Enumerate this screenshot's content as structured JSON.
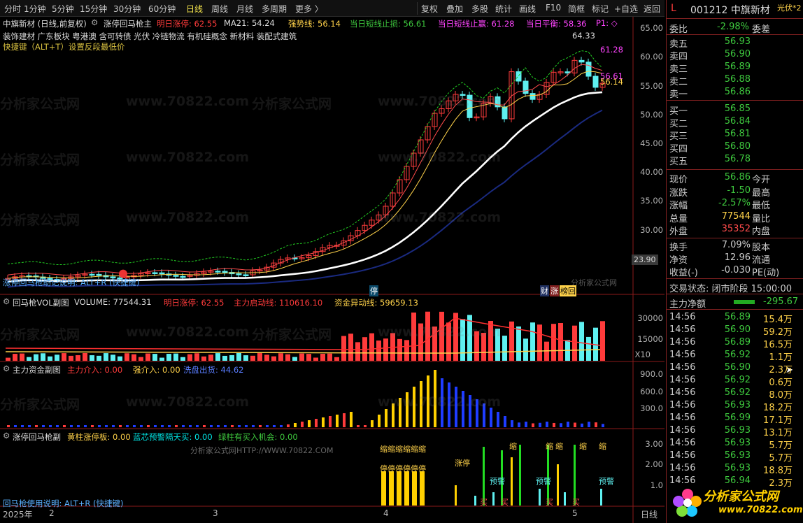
{
  "toolbar": {
    "periods": [
      "分时",
      "1分钟",
      "5分钟",
      "15分钟",
      "30分钟",
      "60分钟",
      "日线",
      "周线",
      "月线",
      "多周期",
      "更多 〉"
    ],
    "active_period": "日线",
    "right": [
      "复权",
      "叠加",
      "多股",
      "统计",
      "画线",
      "F10",
      "简框",
      "标记",
      "+自选",
      "返回"
    ]
  },
  "main_chart": {
    "title": "中旗新材 (日线,前复权)",
    "indicator_name": "涨停回马枪主",
    "tomorrow_limit_label": "明日涨停: 62.55",
    "ma21_label": "MA21: 54.24",
    "strong_line_label": "强势线: 56.14",
    "short_stop_loss_label": "当日短线止损: 56.61",
    "short_stop_profit_label": "当日短线止赢: 61.28",
    "balance_label": "当日平衡: 58.36",
    "p1_label": "P1: ◇",
    "concepts": "装饰建材 广东板块 粤港澳 含可转债 光伏 冷链物流 有机硅概念 新材料 装配式建筑",
    "hotkey_hint": "快捷键（ALT+T）设置反段最低价",
    "usage_hint": "涨停回马枪助记说明: ALT+R (快捷键)",
    "high_marker": "64.33",
    "right_marker_top": "61.28",
    "right_marker_mid": "56.61",
    "right_marker_low": "56.14",
    "price_readout": "23.90",
    "tags": {
      "stop": "停",
      "fin": "财",
      "zhang": "涨",
      "bang": "榜回"
    },
    "y_ticks": [
      "65.00",
      "60.00",
      "55.00",
      "50.00",
      "45.00",
      "40.00",
      "35.00",
      "30.00"
    ]
  },
  "vol_panel": {
    "title": "回马枪VOL副图",
    "volume_label": "VOLUME: 77544.31",
    "tomorrow_limit_label": "明日涨停: 62.55",
    "main_start_label": "主力启动线: 110616.10",
    "fund_move_label": "资金异动线: 59659.13",
    "y_ticks": [
      "30000",
      "15000"
    ],
    "unit": "X10"
  },
  "fund_panel": {
    "title": "主力资金副图",
    "main_in_label": "主力介入: 0.00",
    "strong_in_label": "强介入: 0.00",
    "out_label": "洗盘出货: 44.62",
    "y_ticks": [
      "900.0",
      "600.0",
      "300.0"
    ]
  },
  "zt_panel": {
    "title": "涨停回马枪副",
    "yellow_label": "黄柱涨停板: 0.00",
    "blue_label": "蓝芯预警隔天买: 0.00",
    "green_label": "绿柱有买入机会: 0.00",
    "usage": "回马枪使用说明: ALT+R (快捷键)",
    "y_ticks": [
      "3.00",
      "2.00",
      "1.0"
    ],
    "words": {
      "suo": "缩",
      "ting": "停",
      "zhangting": "涨停",
      "yujing": "预警",
      "mai": "买"
    }
  },
  "x_axis": {
    "year": "2025年",
    "m2": "2",
    "m3": "3",
    "m4": "4",
    "m5": "5"
  },
  "watermarks": {
    "text": "分析家公式网",
    "url": "www.70822.com",
    "small": "分析家公式网HTTP://WWW.70822.COM",
    "small2": "分析家公式网"
  },
  "side": {
    "code_name": "001212 中旗新材",
    "marker": "L",
    "tag": "光伏*2",
    "ratio_label": "委比",
    "ratio_val": "-2.98%",
    "diff_label": "委差",
    "asks": [
      {
        "l": "卖五",
        "p": "56.93"
      },
      {
        "l": "卖四",
        "p": "56.90"
      },
      {
        "l": "卖三",
        "p": "56.89"
      },
      {
        "l": "卖二",
        "p": "56.88"
      },
      {
        "l": "卖一",
        "p": "56.86"
      }
    ],
    "bids": [
      {
        "l": "买一",
        "p": "56.85"
      },
      {
        "l": "买二",
        "p": "56.84"
      },
      {
        "l": "买三",
        "p": "56.81"
      },
      {
        "l": "买四",
        "p": "56.80"
      },
      {
        "l": "买五",
        "p": "56.78"
      }
    ],
    "quote": [
      {
        "l": "现价",
        "v": "56.86",
        "r": "今开"
      },
      {
        "l": "涨跌",
        "v": "-1.50",
        "r": "最高"
      },
      {
        "l": "涨幅",
        "v": "-2.57%",
        "r": "最低"
      },
      {
        "l": "总量",
        "v": "77544",
        "r": "量比"
      },
      {
        "l": "外盘",
        "v": "35352",
        "r": "内盘"
      }
    ],
    "quote2": [
      {
        "l": "换手",
        "v": "7.09%",
        "r": "股本"
      },
      {
        "l": "净资",
        "v": "12.96",
        "r": "流通"
      },
      {
        "l": "收益(-)",
        "v": "-0.030",
        "r": "PE(动)"
      }
    ],
    "state": "交易状态: 闭市阶段 15:00:00",
    "net_label": "主力净额",
    "net_val": "-295.67",
    "ticks": [
      {
        "t": "14:56",
        "p": "56.89",
        "v": "15.4万"
      },
      {
        "t": "14:56",
        "p": "56.90",
        "v": "59.2万"
      },
      {
        "t": "14:56",
        "p": "56.89",
        "v": "16.5万"
      },
      {
        "t": "14:56",
        "p": "56.92",
        "v": "1.1万"
      },
      {
        "t": "14:56",
        "p": "56.90",
        "v": "2.3万"
      },
      {
        "t": "14:56",
        "p": "56.92",
        "v": "0.6万"
      },
      {
        "t": "14:56",
        "p": "56.92",
        "v": "8.0万"
      },
      {
        "t": "14:56",
        "p": "56.93",
        "v": "18.2万"
      },
      {
        "t": "14:56",
        "p": "56.99",
        "v": "17.1万"
      },
      {
        "t": "14:56",
        "p": "56.93",
        "v": "13.1万"
      },
      {
        "t": "14:56",
        "p": "56.93",
        "v": "5.7万"
      },
      {
        "t": "14:56",
        "p": "56.93",
        "v": "5.7万"
      },
      {
        "t": "14:56",
        "p": "56.93",
        "v": "18.8万"
      },
      {
        "t": "14:56",
        "p": "56.94",
        "v": "2.3万"
      }
    ],
    "logo": "分析家公式网",
    "logo_url": "www.70822.com"
  },
  "colors": {
    "up": "#ff3b3b",
    "down": "#5ef0f0",
    "blue_bar": "#1f3cff",
    "yellow": "#ffd000",
    "green": "#22dd22"
  }
}
